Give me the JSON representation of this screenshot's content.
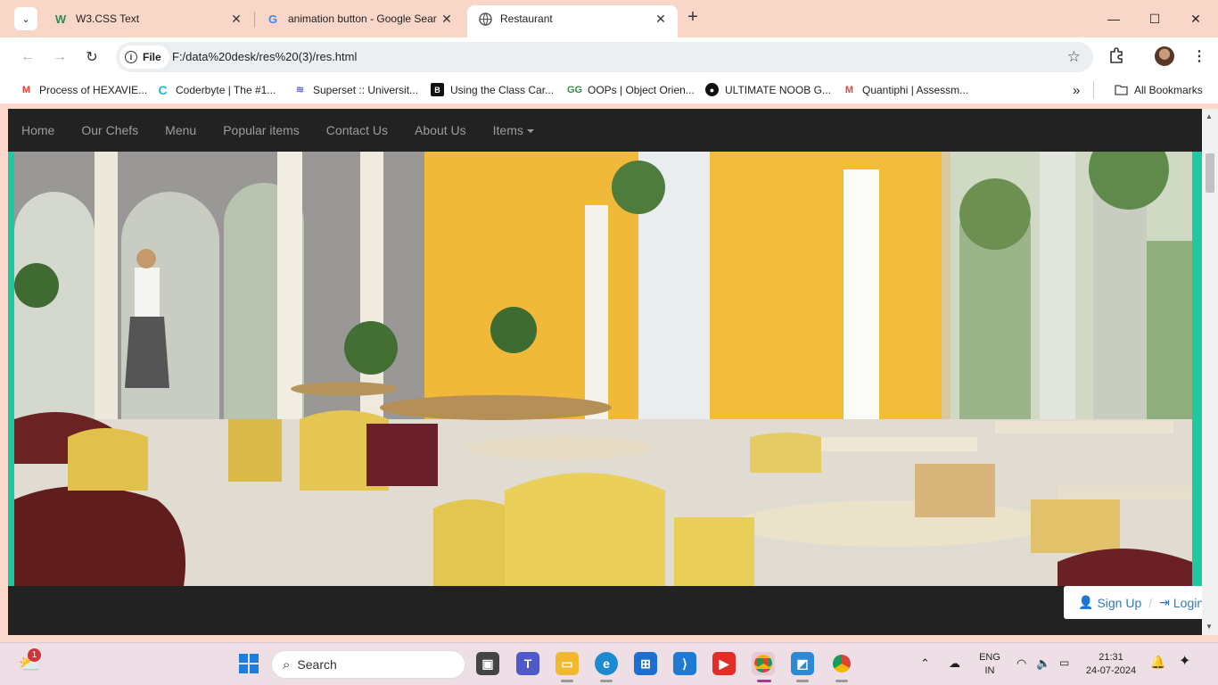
{
  "browser": {
    "tabs": [
      {
        "title": "W3.CSS Text",
        "favicon": "w3-icon",
        "active": false
      },
      {
        "title": "animation button - Google Sear",
        "favicon": "google-icon",
        "active": false
      },
      {
        "title": "Restaurant",
        "favicon": "globe-icon",
        "active": true
      }
    ],
    "address": {
      "chip_label": "File",
      "url": "F:/data%20desk/res%20(3)/res.html"
    },
    "bookmarks": [
      {
        "label": "Process of HEXAVIE...",
        "icon": "gmail-icon"
      },
      {
        "label": "Coderbyte | The #1...",
        "icon": "coderbyte-icon"
      },
      {
        "label": "Superset :: Universit...",
        "icon": "superset-icon"
      },
      {
        "label": "Using the Class Car...",
        "icon": "bookmark-b-icon"
      },
      {
        "label": "OOPs | Object Orien...",
        "icon": "gfg-icon"
      },
      {
        "label": "ULTIMATE NOOB G...",
        "icon": "github-icon"
      },
      {
        "label": "Quantiphi | Assessm...",
        "icon": "gmail-icon"
      }
    ],
    "all_bookmarks_label": "All Bookmarks",
    "overflow_label": "»"
  },
  "site": {
    "nav": [
      "Home",
      "Our Chefs",
      "Menu",
      "Popular items",
      "Contact Us",
      "About Us",
      "Items"
    ],
    "auth": {
      "signup": "Sign Up",
      "login": "Login"
    },
    "colors": {
      "accent": "#1ec8a0",
      "nav_bg": "#222222",
      "link": "#337ab7"
    }
  },
  "taskbar": {
    "search_label": "Search",
    "weather_badge": "1",
    "lang_line1": "ENG",
    "lang_line2": "IN",
    "time": "21:31",
    "date": "24-07-2024"
  }
}
